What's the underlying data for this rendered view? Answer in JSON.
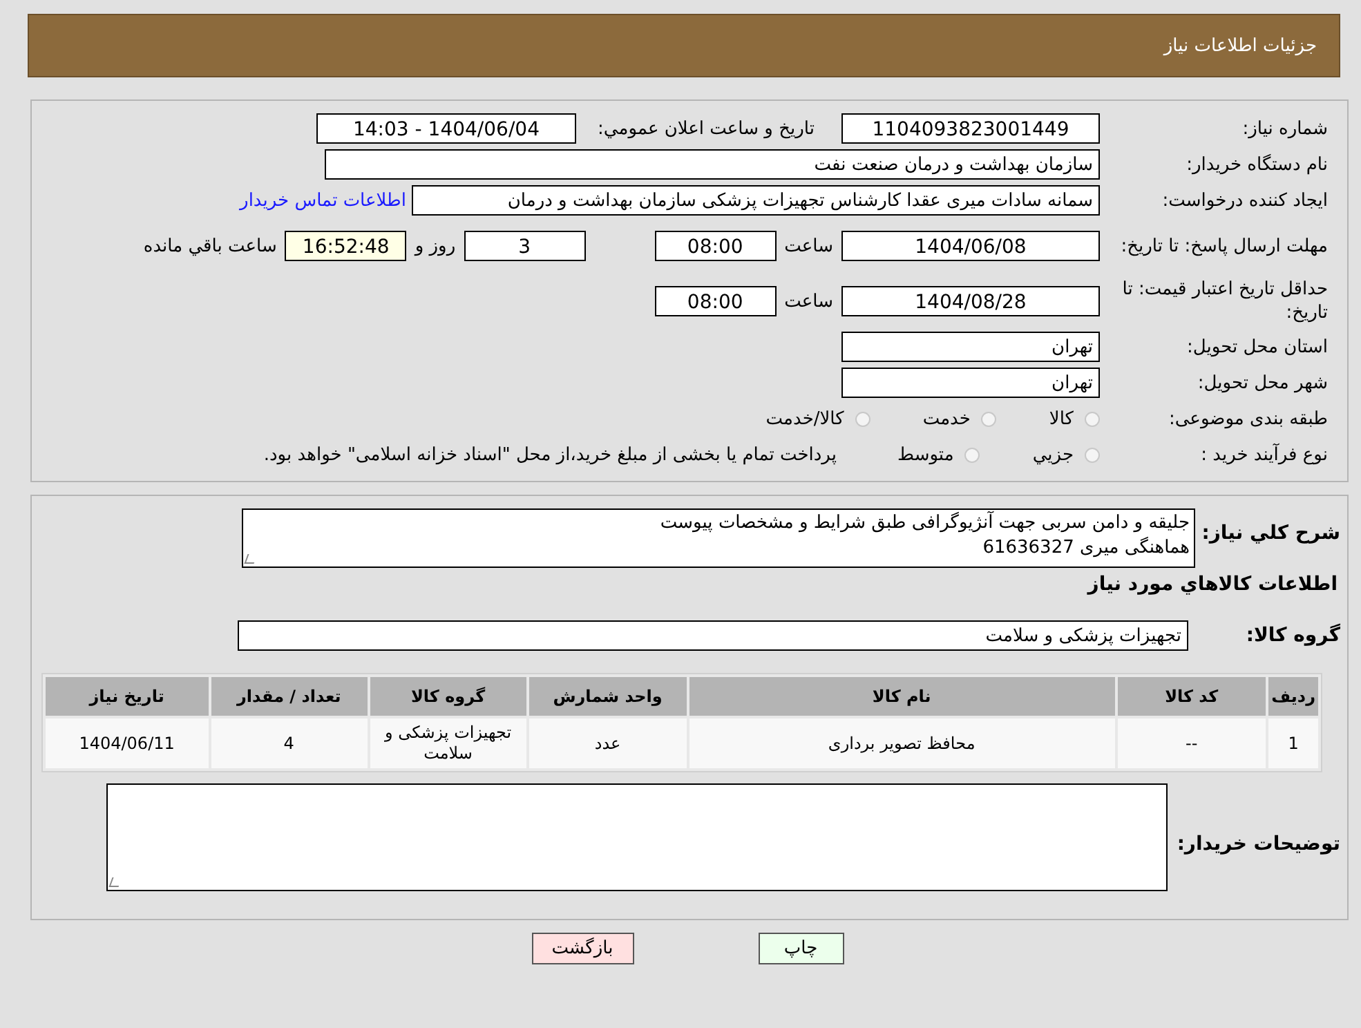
{
  "header": {
    "title": "جزئيات اطلاعات نياز"
  },
  "need_number": {
    "label": "شماره نياز:",
    "value": "1104093823001449"
  },
  "announce": {
    "label": "تاريخ و ساعت اعلان عمومي:",
    "value": "1404/06/04 - 14:03"
  },
  "buyer": {
    "label": "نام دستگاه خريدار:",
    "value": "سازمان بهداشت و درمان صنعت نفت"
  },
  "creator": {
    "label": "ايجاد کننده درخواست:",
    "value": "سمانه سادات میری عقدا کارشناس تجهیزات پزشکی سازمان بهداشت و درمان",
    "link": "اطلاعات تماس خريدار"
  },
  "reply_deadline": {
    "label": "مهلت ارسال پاسخ: تا تاريخ:",
    "date": "1404/06/08",
    "time_label": "ساعت",
    "time": "08:00",
    "days": "3",
    "days_label": "روز و",
    "remaining": "16:52:48",
    "remaining_label": "ساعت باقي مانده"
  },
  "price_validity": {
    "label": "حداقل تاريخ اعتبار قيمت: تا تاريخ:",
    "date": "1404/08/28",
    "time_label": "ساعت",
    "time": "08:00"
  },
  "province": {
    "label": "استان محل تحويل:",
    "value": "تهران"
  },
  "city": {
    "label": "شهر محل تحويل:",
    "value": "تهران"
  },
  "category": {
    "label": "طبقه بندی موضوعی:",
    "options": [
      {
        "label": "کالا",
        "selected": false
      },
      {
        "label": "خدمت",
        "selected": false
      },
      {
        "label": "کالا/خدمت",
        "selected": false
      }
    ]
  },
  "process": {
    "label": "نوع فرآيند خريد :",
    "options": [
      {
        "label": "جزيي",
        "selected": false
      },
      {
        "label": "متوسط",
        "selected": false
      }
    ],
    "note": "پرداخت تمام يا بخشی از مبلغ خريد،از محل \"اسناد خزانه اسلامی\" خواهد بود."
  },
  "description": {
    "label": "شرح کلي نياز:",
    "lines": [
      "جليقه و دامن سربی جهت آنژیوگرافی طبق شرايط و مشخصات پيوست",
      "هماهنگی میری 61636327"
    ]
  },
  "goods_title": "اطلاعات کالاهاي مورد نياز",
  "goods_group": {
    "label": "گروه کالا:",
    "value": "تجهيزات پزشکی و سلامت"
  },
  "table": {
    "columns": [
      "رديف",
      "کد کالا",
      "نام کالا",
      "واحد شمارش",
      "گروه کالا",
      "تعداد / مقدار",
      "تاريخ نياز"
    ],
    "rows": [
      [
        "1",
        "--",
        "محافظ تصویر برداری",
        "عدد",
        "تجهيزات پزشکی و سلامت",
        "4",
        "1404/06/11"
      ]
    ]
  },
  "buyer_notes": {
    "label": "توضيحات خريدار:"
  },
  "buttons": [
    {
      "label": "چاپ",
      "kind": "print"
    },
    {
      "label": "بازگشت",
      "kind": "back"
    }
  ]
}
